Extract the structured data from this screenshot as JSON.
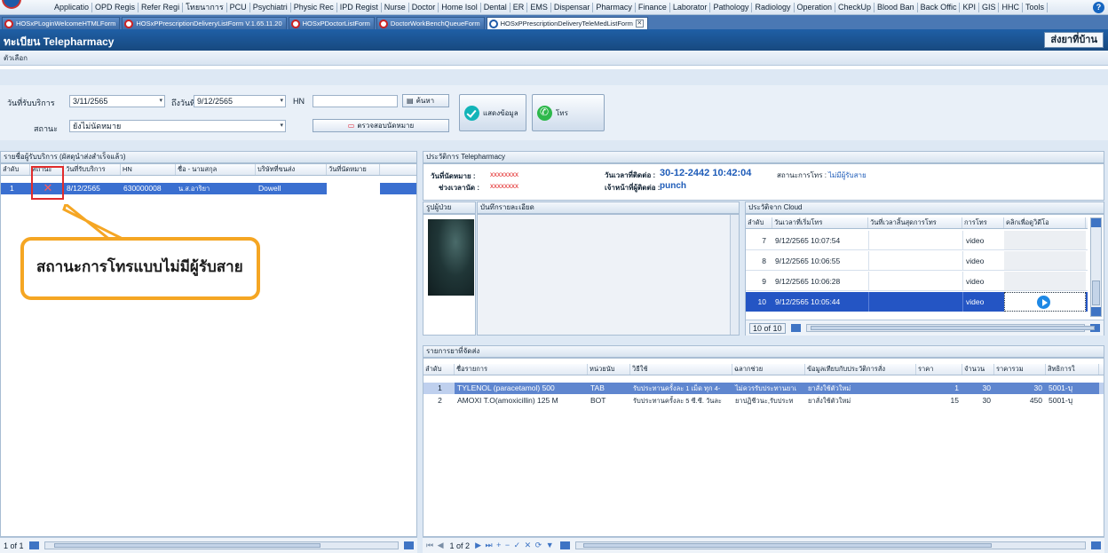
{
  "menu": [
    "Applicatio",
    "OPD Regis",
    "Refer Regi",
    "โทยนาการ",
    "PCU",
    "Psychiatri",
    "Physic Rec",
    "IPD Regist",
    "Nurse",
    "Doctor",
    "Home Isol",
    "Dental",
    "ER",
    "EMS",
    "Dispensar",
    "Pharmacy",
    "Finance",
    "Laborator",
    "Pathology",
    "Radiology",
    "Operation",
    "CheckUp",
    "Blood Ban",
    "Back Offic",
    "KPI",
    "GIS",
    "HHC",
    "Tools"
  ],
  "tabs": [
    "HOSxPLoginWelcomeHTMLForm",
    "HOSxPPrescriptionDeliveryListForm V.1.65.11.20",
    "HOSxPDoctorListForm",
    "DoctorWorkBenchQueueForm",
    "HOSxPPrescriptionDeliveryTeleMedListForm"
  ],
  "header": {
    "title": "ทะเบียน Telepharmacy",
    "home_delivery": "ส่งยาที่บ้าน",
    "options": "ตัวเลือก"
  },
  "filter": {
    "service_date_label": "วันที่รับบริการ",
    "service_date": "3/11/2565",
    "to_date_label": "ถึงวันที่",
    "to_date": "9/12/2565",
    "hn_label": "HN",
    "hn_value": "",
    "search_btn": "ค้นหา",
    "status_label": "สถานะ",
    "status_value": "ยังไม่นัดหมาย",
    "check_appt_btn": "ตรวจสอบนัดหมาย",
    "show_btn": "แสดงข้อมูล",
    "call_btn": "โทร"
  },
  "left": {
    "title": "รายชื่อผู้รับบริการ (ผัสดุนำส่งสำเร็จแล้ว)",
    "columns": [
      "ลำดับ",
      "สถานะ",
      "วันที่รับบริการ",
      "HN",
      "ชื่อ - นามสกุล",
      "บริษัทที่ขนส่ง",
      "วันที่นัดหมาย"
    ],
    "rows": [
      {
        "no": "1",
        "status": "✕",
        "date": "8/12/2565",
        "hn": "630000008",
        "name": "น.ส.อาริยา",
        "company": "Dowell",
        "appt": ""
      }
    ],
    "pager": "1 of 1"
  },
  "history": {
    "title": "ประวัติการ Telepharmacy",
    "appt_label": "วันที่นัดหมาย :",
    "appt_value": "xxxxxxxx",
    "time_label": "ช่วงเวลานัด :",
    "time_value": "xxxxxxxx",
    "contact_label": "วันเวลาที่ติดต่อ :",
    "contact_value": "30-12-2442 10:42:04",
    "call_status_label": "สถานะการโทร :",
    "call_status_value": "ไม่มีผู้รับสาย",
    "officer_label": "เจ้าหน้าที่ผู้ติดต่อ :",
    "officer_value": "punch",
    "patient_photo": "รูปผู้ป่วย",
    "detail_note": "บันทึกรายละเอียด"
  },
  "cloud": {
    "title": "ประวัติจาก Cloud",
    "columns": [
      "ลำดับ",
      "วันเวลาที่เริ่มโทร",
      "วันที่เวลาสิ้นสุดการโทร",
      "การโทร",
      "คลิกเพื่อดูวิดีโอ"
    ],
    "rows": [
      {
        "no": "7",
        "start": "9/12/2565 10:07:54",
        "end": "",
        "type": "video"
      },
      {
        "no": "8",
        "start": "9/12/2565 10:06:55",
        "end": "",
        "type": "video"
      },
      {
        "no": "9",
        "start": "9/12/2565 10:06:28",
        "end": "",
        "type": "video"
      },
      {
        "no": "10",
        "start": "9/12/2565 10:05:44",
        "end": "",
        "type": "video"
      }
    ],
    "pager": "10 of 10"
  },
  "drugs": {
    "title": "รายการยาที่จัดส่ง",
    "columns": [
      "ลำดับ",
      "ชื่อรายการ",
      "หน่วยนับ",
      "วิธีใช้",
      "ฉลากช่วย",
      "ข้อมูลเทียบกับประวัติการสั่ง",
      "ราคา",
      "จำนวน",
      "ราคารวม",
      "สิทธิการใ"
    ],
    "rows": [
      {
        "no": "1",
        "name": "TYLENOL (paracetamol) 500",
        "unit": "TAB",
        "usage": "รับประทานครั้งละ 1 เม็ด ทุก 4-",
        "label": "ไม่ควรรับประทานยาเ",
        "compare": "ยาสั่งใช้ตัวใหม่",
        "price": "1",
        "qty": "30",
        "total": "30",
        "right": "5001-บุ"
      },
      {
        "no": "2",
        "name": "AMOXI T.O(amoxicillin) 125 M",
        "unit": "BOT",
        "usage": "รับประทานครั้งละ 5 ซี.ซี. วันละ",
        "label": "ยาปฏิชีวนะ,รับประท",
        "compare": "ยาสั่งใช้ตัวใหม่",
        "price": "15",
        "qty": "30",
        "total": "450",
        "right": "5001-บุ"
      }
    ],
    "pager": "1 of 2"
  },
  "annotation": "สถานะการโทรแบบไม่มีผู้รับสาย"
}
